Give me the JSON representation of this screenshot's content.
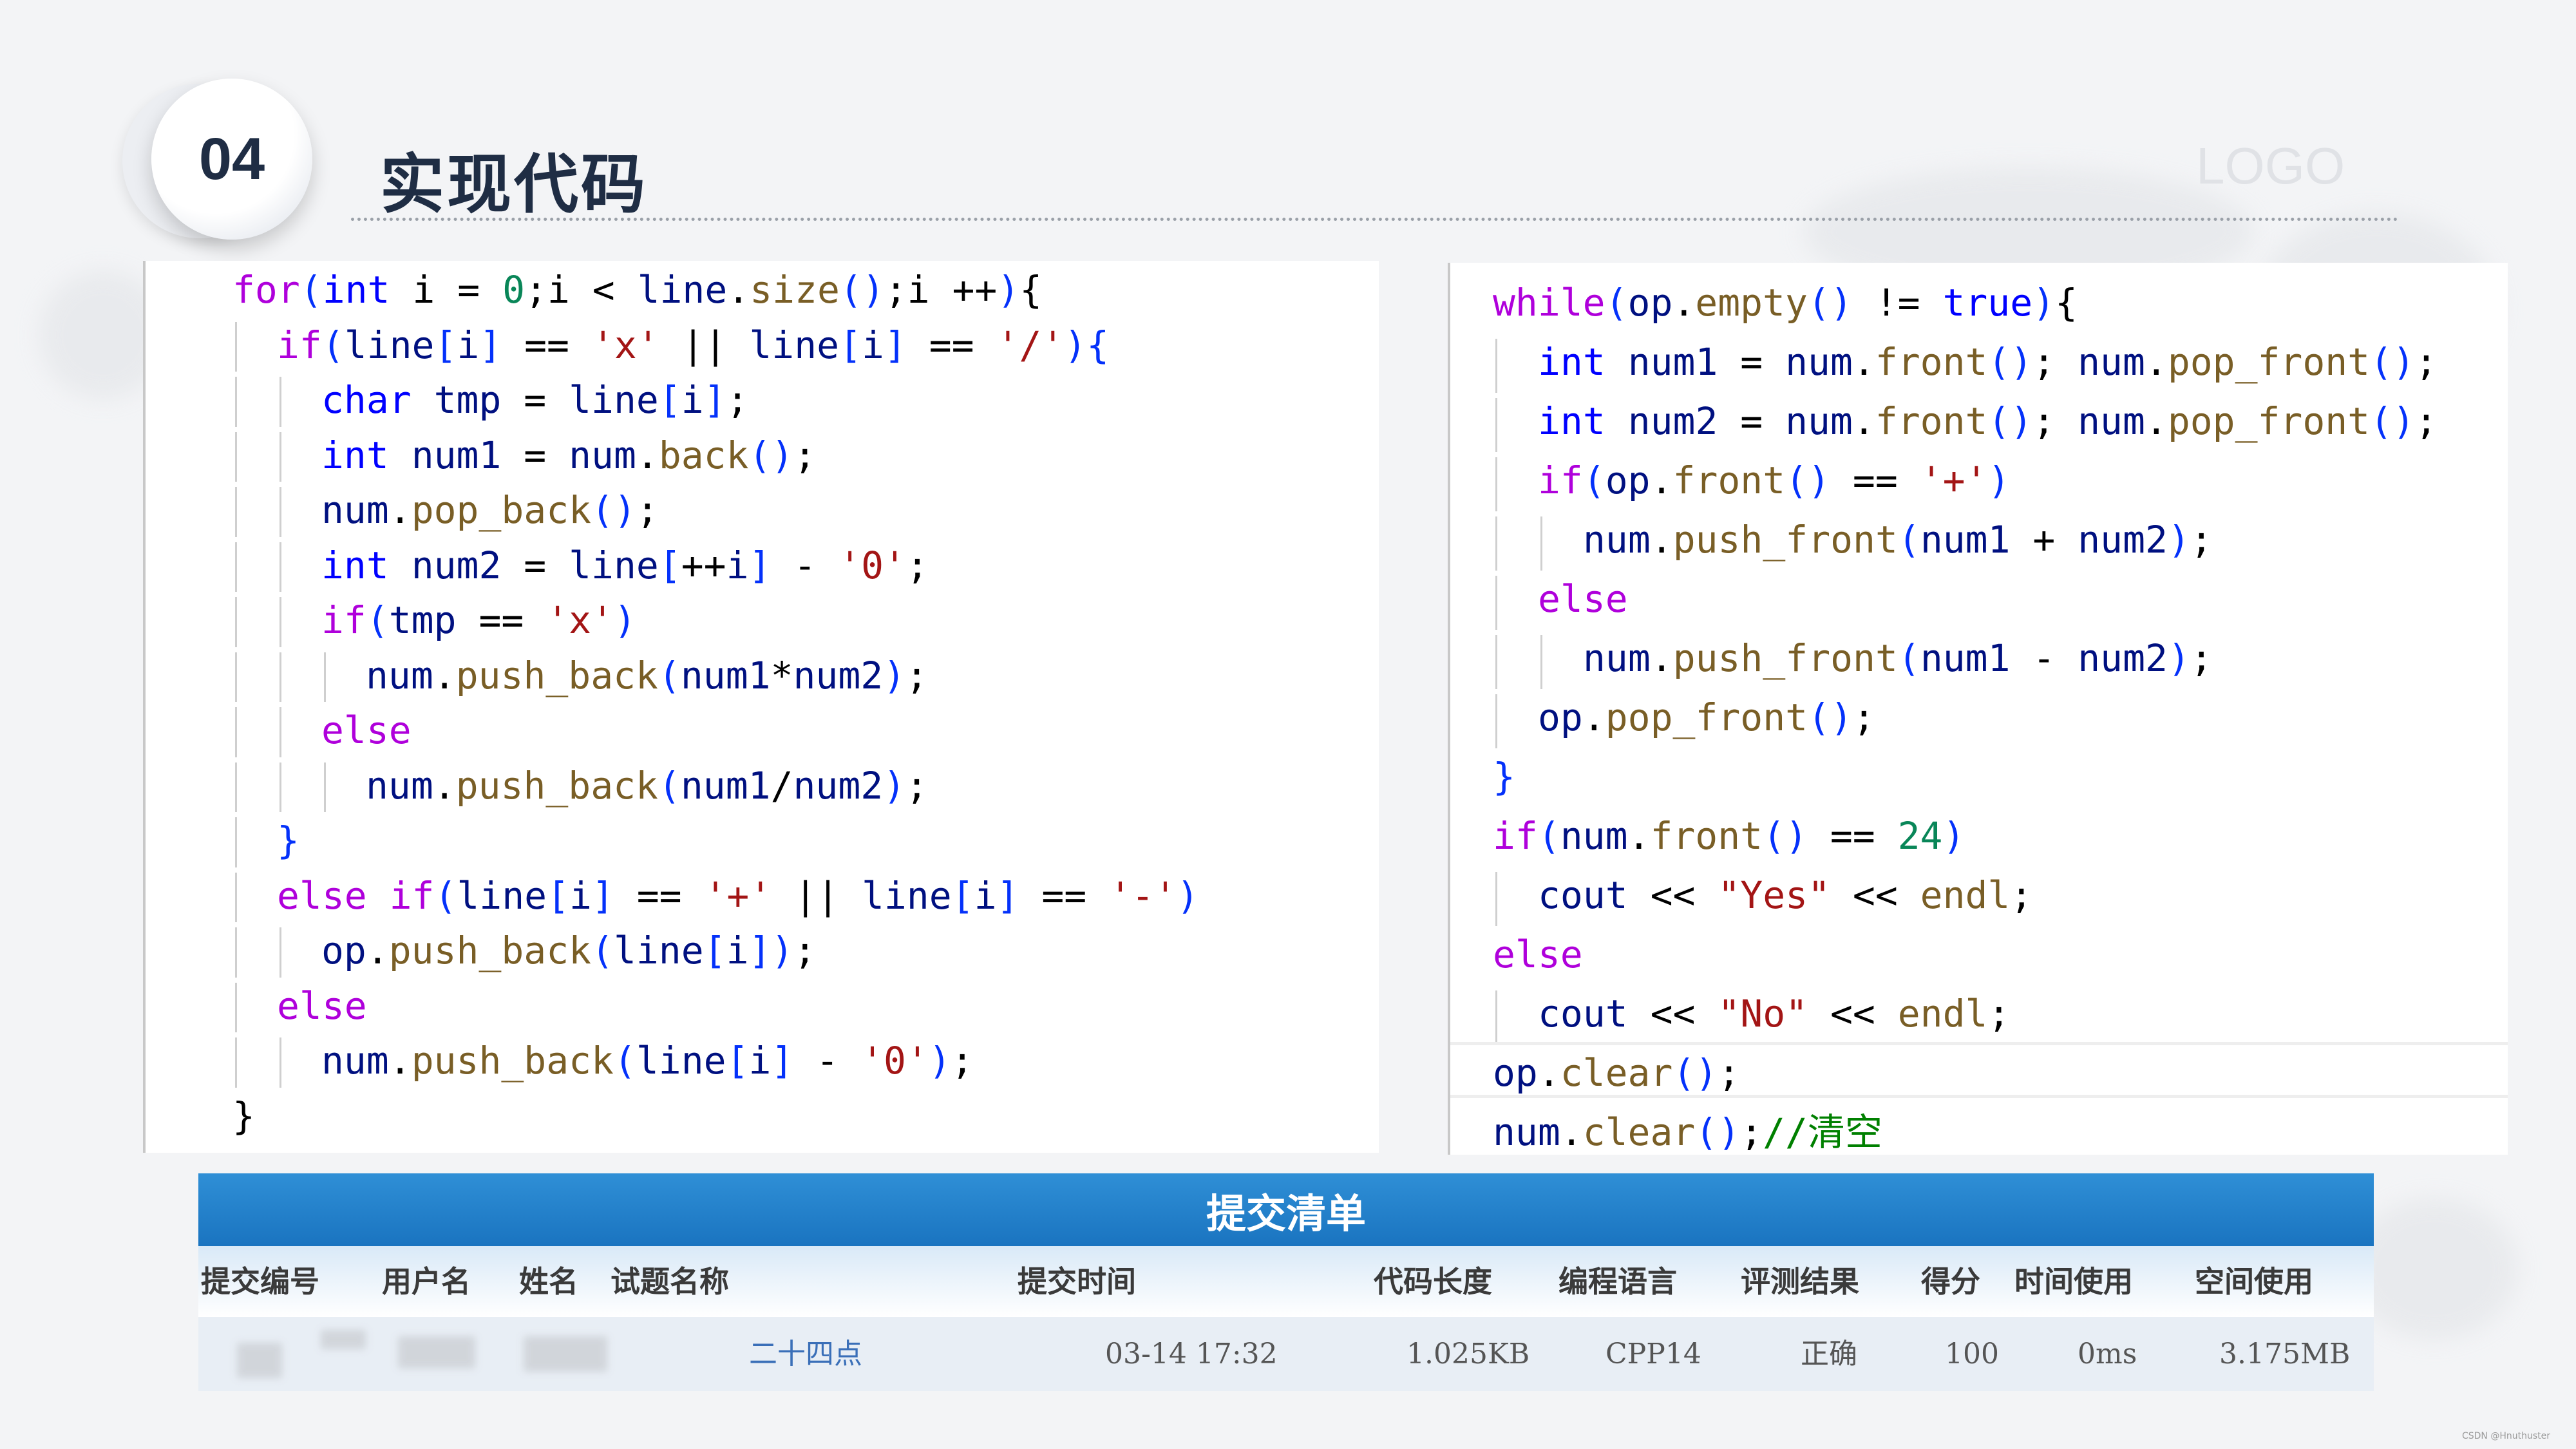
{
  "header": {
    "section_number": "04",
    "title": "实现代码",
    "logo": "LOGO"
  },
  "left_code": [
    {
      "indent": 0,
      "tokens": [
        [
          "kwp",
          "for"
        ],
        [
          "pu",
          "("
        ],
        [
          "kw",
          "int"
        ],
        [
          "op",
          " i = "
        ],
        [
          "n",
          "0"
        ],
        [
          "op",
          ";i < "
        ],
        [
          "id",
          "line"
        ],
        [
          "op",
          "."
        ],
        [
          "fn",
          "size"
        ],
        [
          "pu",
          "()"
        ],
        [
          "op",
          ";i ++"
        ],
        [
          "pu",
          ")"
        ],
        [
          "op",
          "{"
        ]
      ]
    },
    {
      "indent": 1,
      "tokens": [
        [
          "kwp",
          "if"
        ],
        [
          "pu",
          "("
        ],
        [
          "id",
          "line"
        ],
        [
          "pu",
          "["
        ],
        [
          "id",
          "i"
        ],
        [
          "pu",
          "]"
        ],
        [
          "op",
          " == "
        ],
        [
          "str",
          "'x'"
        ],
        [
          "op",
          " || "
        ],
        [
          "id",
          "line"
        ],
        [
          "pu",
          "["
        ],
        [
          "id",
          "i"
        ],
        [
          "pu",
          "]"
        ],
        [
          "op",
          " == "
        ],
        [
          "str",
          "'/'"
        ],
        [
          "pu",
          ")"
        ],
        [
          "pu",
          "{"
        ]
      ]
    },
    {
      "indent": 2,
      "tokens": [
        [
          "kw",
          "char"
        ],
        [
          "op",
          " "
        ],
        [
          "id",
          "tmp"
        ],
        [
          "op",
          " = "
        ],
        [
          "id",
          "line"
        ],
        [
          "pu",
          "["
        ],
        [
          "id",
          "i"
        ],
        [
          "pu",
          "]"
        ],
        [
          "op",
          ";"
        ]
      ]
    },
    {
      "indent": 2,
      "tokens": [
        [
          "kw",
          "int"
        ],
        [
          "op",
          " "
        ],
        [
          "id",
          "num1"
        ],
        [
          "op",
          " = "
        ],
        [
          "id",
          "num"
        ],
        [
          "op",
          "."
        ],
        [
          "fn",
          "back"
        ],
        [
          "pu",
          "()"
        ],
        [
          "op",
          ";"
        ]
      ]
    },
    {
      "indent": 2,
      "tokens": [
        [
          "id",
          "num"
        ],
        [
          "op",
          "."
        ],
        [
          "fn",
          "pop_back"
        ],
        [
          "pu",
          "()"
        ],
        [
          "op",
          ";"
        ]
      ]
    },
    {
      "indent": 2,
      "tokens": [
        [
          "kw",
          "int"
        ],
        [
          "op",
          " "
        ],
        [
          "id",
          "num2"
        ],
        [
          "op",
          " = "
        ],
        [
          "id",
          "line"
        ],
        [
          "pu",
          "["
        ],
        [
          "op",
          "++"
        ],
        [
          "id",
          "i"
        ],
        [
          "pu",
          "]"
        ],
        [
          "op",
          " - "
        ],
        [
          "str",
          "'0'"
        ],
        [
          "op",
          ";"
        ]
      ]
    },
    {
      "indent": 2,
      "tokens": [
        [
          "kwp",
          "if"
        ],
        [
          "pu",
          "("
        ],
        [
          "id",
          "tmp"
        ],
        [
          "op",
          " == "
        ],
        [
          "str",
          "'x'"
        ],
        [
          "pu",
          ")"
        ]
      ]
    },
    {
      "indent": 3,
      "tokens": [
        [
          "id",
          "num"
        ],
        [
          "op",
          "."
        ],
        [
          "fn",
          "push_back"
        ],
        [
          "pu",
          "("
        ],
        [
          "id",
          "num1"
        ],
        [
          "op",
          "*"
        ],
        [
          "id",
          "num2"
        ],
        [
          "pu",
          ")"
        ],
        [
          "op",
          ";"
        ]
      ]
    },
    {
      "indent": 2,
      "tokens": [
        [
          "kwp",
          "else"
        ]
      ]
    },
    {
      "indent": 3,
      "tokens": [
        [
          "id",
          "num"
        ],
        [
          "op",
          "."
        ],
        [
          "fn",
          "push_back"
        ],
        [
          "pu",
          "("
        ],
        [
          "id",
          "num1"
        ],
        [
          "op",
          "/"
        ],
        [
          "id",
          "num2"
        ],
        [
          "pu",
          ")"
        ],
        [
          "op",
          ";"
        ]
      ]
    },
    {
      "indent": 1,
      "tokens": [
        [
          "pu",
          "}"
        ]
      ]
    },
    {
      "indent": 1,
      "tokens": [
        [
          "kwp",
          "else"
        ],
        [
          "op",
          " "
        ],
        [
          "kwp",
          "if"
        ],
        [
          "pu",
          "("
        ],
        [
          "id",
          "line"
        ],
        [
          "pu",
          "["
        ],
        [
          "id",
          "i"
        ],
        [
          "pu",
          "]"
        ],
        [
          "op",
          " == "
        ],
        [
          "str",
          "'+'"
        ],
        [
          "op",
          " || "
        ],
        [
          "id",
          "line"
        ],
        [
          "pu",
          "["
        ],
        [
          "id",
          "i"
        ],
        [
          "pu",
          "]"
        ],
        [
          "op",
          " == "
        ],
        [
          "str",
          "'-'"
        ],
        [
          "pu",
          ")"
        ]
      ]
    },
    {
      "indent": 2,
      "tokens": [
        [
          "id",
          "op"
        ],
        [
          "op",
          "."
        ],
        [
          "fn",
          "push_back"
        ],
        [
          "pu",
          "("
        ],
        [
          "id",
          "line"
        ],
        [
          "pu",
          "["
        ],
        [
          "id",
          "i"
        ],
        [
          "pu",
          "])"
        ],
        [
          "op",
          ";"
        ]
      ]
    },
    {
      "indent": 1,
      "tokens": [
        [
          "kwp",
          "else"
        ]
      ]
    },
    {
      "indent": 2,
      "tokens": [
        [
          "id",
          "num"
        ],
        [
          "op",
          "."
        ],
        [
          "fn",
          "push_back"
        ],
        [
          "pu",
          "("
        ],
        [
          "id",
          "line"
        ],
        [
          "pu",
          "["
        ],
        [
          "id",
          "i"
        ],
        [
          "pu",
          "]"
        ],
        [
          "op",
          " - "
        ],
        [
          "str",
          "'0'"
        ],
        [
          "pu",
          ")"
        ],
        [
          "op",
          ";"
        ]
      ]
    },
    {
      "indent": 0,
      "tokens": [
        [
          "op",
          "}"
        ]
      ]
    }
  ],
  "right_code": [
    {
      "indent": 0,
      "tokens": [
        [
          "kwp",
          "while"
        ],
        [
          "pu",
          "("
        ],
        [
          "id",
          "op"
        ],
        [
          "op",
          "."
        ],
        [
          "fn",
          "empty"
        ],
        [
          "pu",
          "()"
        ],
        [
          "op",
          " != "
        ],
        [
          "kw",
          "true"
        ],
        [
          "pu",
          ")"
        ],
        [
          "op",
          "{"
        ]
      ]
    },
    {
      "indent": 1,
      "tokens": [
        [
          "kw",
          "int"
        ],
        [
          "op",
          " "
        ],
        [
          "id",
          "num1"
        ],
        [
          "op",
          " = "
        ],
        [
          "id",
          "num"
        ],
        [
          "op",
          "."
        ],
        [
          "fn",
          "front"
        ],
        [
          "pu",
          "()"
        ],
        [
          "op",
          "; "
        ],
        [
          "id",
          "num"
        ],
        [
          "op",
          "."
        ],
        [
          "fn",
          "pop_front"
        ],
        [
          "pu",
          "()"
        ],
        [
          "op",
          ";"
        ]
      ]
    },
    {
      "indent": 1,
      "tokens": [
        [
          "kw",
          "int"
        ],
        [
          "op",
          " "
        ],
        [
          "id",
          "num2"
        ],
        [
          "op",
          " = "
        ],
        [
          "id",
          "num"
        ],
        [
          "op",
          "."
        ],
        [
          "fn",
          "front"
        ],
        [
          "pu",
          "()"
        ],
        [
          "op",
          "; "
        ],
        [
          "id",
          "num"
        ],
        [
          "op",
          "."
        ],
        [
          "fn",
          "pop_front"
        ],
        [
          "pu",
          "()"
        ],
        [
          "op",
          ";"
        ]
      ]
    },
    {
      "indent": 1,
      "tokens": [
        [
          "kwp",
          "if"
        ],
        [
          "pu",
          "("
        ],
        [
          "id",
          "op"
        ],
        [
          "op",
          "."
        ],
        [
          "fn",
          "front"
        ],
        [
          "pu",
          "()"
        ],
        [
          "op",
          " == "
        ],
        [
          "str",
          "'+'"
        ],
        [
          "pu",
          ")"
        ]
      ]
    },
    {
      "indent": 2,
      "tokens": [
        [
          "id",
          "num"
        ],
        [
          "op",
          "."
        ],
        [
          "fn",
          "push_front"
        ],
        [
          "pu",
          "("
        ],
        [
          "id",
          "num1"
        ],
        [
          "op",
          " + "
        ],
        [
          "id",
          "num2"
        ],
        [
          "pu",
          ")"
        ],
        [
          "op",
          ";"
        ]
      ]
    },
    {
      "indent": 1,
      "tokens": [
        [
          "kwp",
          "else"
        ]
      ]
    },
    {
      "indent": 2,
      "tokens": [
        [
          "id",
          "num"
        ],
        [
          "op",
          "."
        ],
        [
          "fn",
          "push_front"
        ],
        [
          "pu",
          "("
        ],
        [
          "id",
          "num1"
        ],
        [
          "op",
          " - "
        ],
        [
          "id",
          "num2"
        ],
        [
          "pu",
          ")"
        ],
        [
          "op",
          ";"
        ]
      ]
    },
    {
      "indent": 1,
      "tokens": [
        [
          "id",
          "op"
        ],
        [
          "op",
          "."
        ],
        [
          "fn",
          "pop_front"
        ],
        [
          "pu",
          "()"
        ],
        [
          "op",
          ";"
        ]
      ]
    },
    {
      "indent": 0,
      "tokens": [
        [
          "pu",
          "}"
        ]
      ]
    },
    {
      "indent": 0,
      "tokens": [
        [
          "kwp",
          "if"
        ],
        [
          "pu",
          "("
        ],
        [
          "id",
          "num"
        ],
        [
          "op",
          "."
        ],
        [
          "fn",
          "front"
        ],
        [
          "pu",
          "()"
        ],
        [
          "op",
          " == "
        ],
        [
          "n",
          "24"
        ],
        [
          "pu",
          ")"
        ]
      ]
    },
    {
      "indent": 1,
      "tokens": [
        [
          "id",
          "cout"
        ],
        [
          "op",
          " << "
        ],
        [
          "str",
          "\"Yes\""
        ],
        [
          "op",
          " << "
        ],
        [
          "fn",
          "endl"
        ],
        [
          "op",
          ";"
        ]
      ]
    },
    {
      "indent": 0,
      "tokens": [
        [
          "kwp",
          "else"
        ]
      ]
    },
    {
      "indent": 1,
      "tokens": [
        [
          "id",
          "cout"
        ],
        [
          "op",
          " << "
        ],
        [
          "str",
          "\"No\""
        ],
        [
          "op",
          " << "
        ],
        [
          "fn",
          "endl"
        ],
        [
          "op",
          ";"
        ]
      ]
    },
    {
      "indent": 0,
      "tokens": [
        [
          "id",
          "op"
        ],
        [
          "op",
          "."
        ],
        [
          "fn",
          "clear"
        ],
        [
          "pu",
          "()"
        ],
        [
          "op",
          ";"
        ]
      ]
    },
    {
      "indent": 0,
      "tokens": [
        [
          "id",
          "num"
        ],
        [
          "op",
          "."
        ],
        [
          "fn",
          "clear"
        ],
        [
          "pu",
          "()"
        ],
        [
          "op",
          ";"
        ],
        [
          "cm",
          "//清空"
        ]
      ]
    }
  ],
  "submission_table": {
    "title": "提交清单",
    "columns": [
      "提交编号",
      "用户名",
      "姓名",
      "试题名称",
      "提交时间",
      "代码长度",
      "编程语言",
      "评测结果",
      "得分",
      "时间使用",
      "空间使用"
    ],
    "rows": [
      {
        "problem": "二十四点",
        "time": "03-14 17:32",
        "code_length": "1.025KB",
        "language": "CPP14",
        "result": "正确",
        "score": "100",
        "time_used": "0ms",
        "memory_used": "3.175MB"
      }
    ]
  },
  "footer_credit": "CSDN @Hnuthuster",
  "colors": {
    "title": "#1f2d44",
    "table_header": "#1a74c0",
    "link": "#3a6fb8"
  }
}
